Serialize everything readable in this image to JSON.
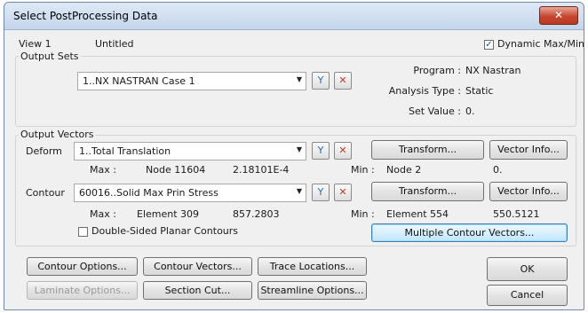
{
  "window": {
    "title": "Select PostProcessing Data",
    "close_glyph": "✕"
  },
  "view": {
    "label": "View 1",
    "name": "Untitled"
  },
  "dynamic_maxmin": {
    "label": "Dynamic Max/Min",
    "checked": true,
    "check_glyph": "✓"
  },
  "output_sets": {
    "label": "Output Sets",
    "selected": "1..NX NASTRAN Case 1",
    "program_label": "Program :",
    "program_value": "NX Nastran",
    "analysis_label": "Analysis Type :",
    "analysis_value": "Static",
    "setvalue_label": "Set Value :",
    "setvalue_value": "0."
  },
  "output_vectors": {
    "label": "Output Vectors",
    "deform": {
      "label": "Deform",
      "selected": "1..Total Translation",
      "max_label": "Max :",
      "max_loc": "Node  11604",
      "max_value": "2.18101E-4",
      "min_label": "Min :",
      "min_loc": "Node  2",
      "min_value": "0."
    },
    "contour": {
      "label": "Contour",
      "selected": "60016..Solid Max Prin Stress",
      "max_label": "Max :",
      "max_loc": "Element  309",
      "max_value": "857.2803",
      "min_label": "Min :",
      "min_loc": "Element  554",
      "min_value": "550.5121"
    },
    "double_sided": {
      "label": "Double-Sided Planar Contours",
      "checked": false
    },
    "transform_label": "Transform...",
    "vector_info_label": "Vector Info...",
    "multiple_contour_label": "Multiple Contour Vectors..."
  },
  "icons": {
    "dropdown": "▼",
    "select": "Y",
    "clear": "✕"
  },
  "buttons": {
    "contour_options": "Contour Options...",
    "contour_vectors": "Contour Vectors...",
    "trace_locations": "Trace Locations...",
    "laminate_options": "Laminate Options...",
    "section_cut": "Section Cut...",
    "streamline_options": "Streamline Options...",
    "ok": "OK",
    "cancel": "Cancel"
  }
}
